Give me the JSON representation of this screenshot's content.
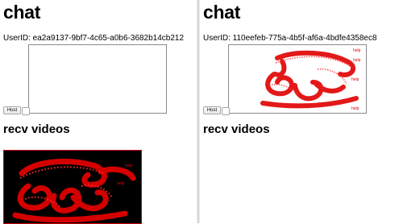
{
  "left": {
    "title": "chat",
    "user_id_label": "UserID: ea2a9137-9bf7-4c65-a0b6-3682b14cb212",
    "host_button": "Host",
    "recv_heading": "recv videos",
    "video_labels": [
      "help",
      "help",
      "help"
    ]
  },
  "right": {
    "title": "chat",
    "user_id_label": "UserID: 110eefeb-775a-4b5f-af6a-4bdfe4358ec8",
    "host_button": "Host",
    "recv_heading": "recv videos",
    "canvas_labels": [
      "help",
      "help",
      "help",
      "help"
    ]
  },
  "colors": {
    "ink": "#e00000",
    "video_bg": "#000000",
    "video_border": "#c00000"
  },
  "icons": {
    "host_checkbox": "checkbox-icon"
  }
}
